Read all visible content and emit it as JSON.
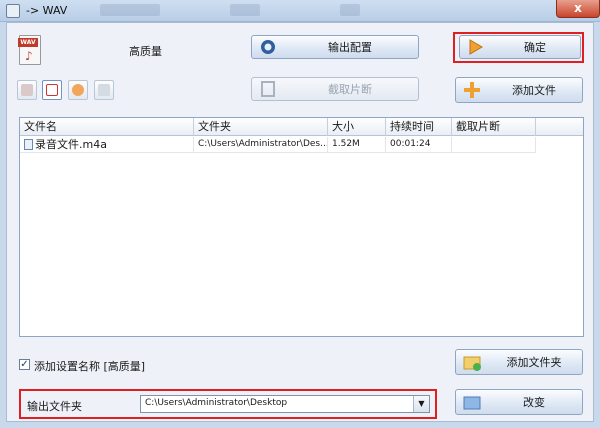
{
  "window": {
    "title": "-> WAV",
    "close_symbol": "x"
  },
  "header": {
    "format_icon_text": "WAV",
    "quality_label": "高质量"
  },
  "buttons": {
    "output_config": "输出配置",
    "ok": "确定",
    "cut_clip": "截取片断",
    "add_file": "添加文件",
    "add_folder": "添加文件夹",
    "change": "改变"
  },
  "toolbar": {
    "items": [
      "clear-list-icon",
      "remove-file-icon",
      "play-icon",
      "media-info-icon"
    ]
  },
  "table": {
    "columns": [
      "文件名",
      "文件夹",
      "大小",
      "持续时间",
      "截取片断"
    ],
    "rows": [
      {
        "name": "录音文件.m4a",
        "folder": "C:\\Users\\Administrator\\Des...",
        "size": "1.52M",
        "duration": "00:01:24",
        "clip": ""
      }
    ]
  },
  "options": {
    "add_setting_name_label": "添加设置名称 [高质量]",
    "add_setting_name_checked": true,
    "check_mark": "✓"
  },
  "output": {
    "folder_label": "输出文件夹",
    "folder_value": "C:\\Users\\Administrator\\Desktop",
    "dropdown_arrow": "▼"
  },
  "colors": {
    "highlight": "#e02020",
    "accent": "#8ea5c4"
  }
}
